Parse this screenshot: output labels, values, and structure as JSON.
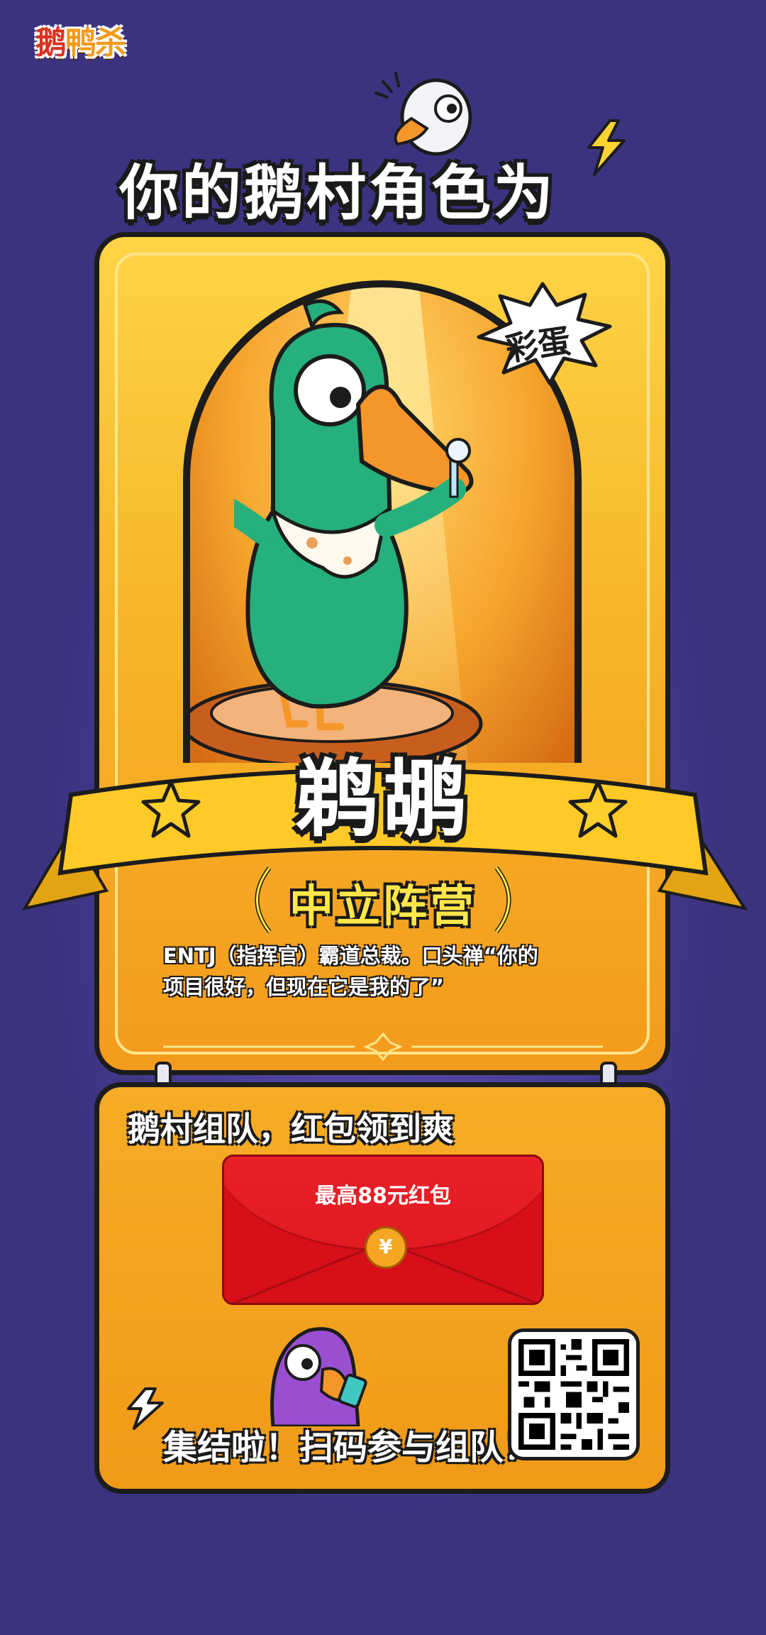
{
  "logo": {
    "text_a": "鹅",
    "text_b": "鸭杀"
  },
  "headline": "你的鹅村角色为",
  "card": {
    "sticker": "彩蛋",
    "role_name": "鹈鹕",
    "faction": "中立阵营",
    "description_line1": "ENTJ（指挥官）霸道总裁。口头禅“你的",
    "description_line2": "项目很好，但现在它是我的了”"
  },
  "panel": {
    "title": "鹅村组队，红包领到爽",
    "envelope_label": "最高88元红包",
    "envelope_symbol": "¥",
    "footer": "集结啦！扫码参与组队！",
    "qr_icon": "qr-code"
  },
  "colors": {
    "background": "#3b3380",
    "card_gold": "#f7b52a",
    "envelope_red": "#d70f18",
    "pelican_green": "#25b07d"
  }
}
